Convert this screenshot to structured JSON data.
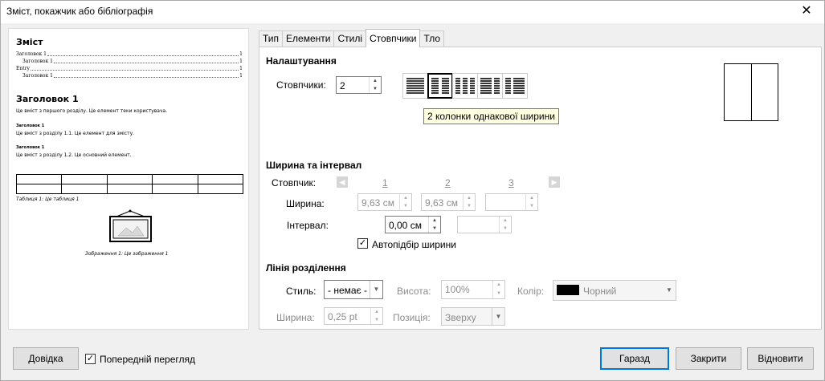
{
  "window": {
    "title": "Зміст, покажчик або бібліографія",
    "close_glyph": "✕"
  },
  "preview": {
    "toc_title": "Зміст",
    "toc_lines": [
      {
        "text": "Заголовок 1",
        "page": "1"
      },
      {
        "text": "Заголовок 1",
        "page": "1"
      },
      {
        "text": "Entry",
        "page": "1"
      },
      {
        "text": "Заголовок 1",
        "page": "1"
      }
    ],
    "heading1": "Заголовок 1",
    "text1": "Це вміст з першого розділу. Це елемент теки користувача.",
    "heading_a": "Заголовок 1",
    "text_a": "Це вміст з розділу 1.1. Це елемент для змісту.",
    "heading_b": "Заголовок 1",
    "text_b": "Це вміст з розділу 1.2. Це основний елемент.",
    "table_caption": "Таблиця 1: Це таблиця 1",
    "image_caption": "Зображення 1: Це зображення 1"
  },
  "tabs": [
    {
      "label": "Тип"
    },
    {
      "label": "Елементи"
    },
    {
      "label": "Стилі"
    },
    {
      "label": "Стовпчики",
      "active": true
    },
    {
      "label": "Тло"
    }
  ],
  "settings": {
    "title": "Налаштування",
    "columns_label": "Стовпчики:",
    "columns_value": "2",
    "presets": [
      "1 колонка",
      "2 колонки однакової ширини",
      "3 колонки",
      "2 колонки (ліва ширша)",
      "2 колонки (права ширша)"
    ],
    "tooltip": "2 колонки однакової ширини"
  },
  "width_spacing": {
    "title": "Ширина та інтервал",
    "column_label": "Стовпчик:",
    "col_numbers": [
      "1",
      "2",
      "3"
    ],
    "width_label": "Ширина:",
    "widths": [
      "9,63 см",
      "9,63 см",
      ""
    ],
    "spacing_label": "Інтервал:",
    "spacings": [
      "0,00 см",
      ""
    ],
    "autofit_label": "Автопідбір ширини",
    "autofit_checked": true
  },
  "separator": {
    "title": "Лінія розділення",
    "style_label": "Стиль:",
    "style_value": "- немає -",
    "height_label": "Висота:",
    "height_value": "100%",
    "color_label": "Колір:",
    "color_value": "Чорний",
    "color_hex": "#000000",
    "width_label": "Ширина:",
    "width_value": "0,25 pt",
    "position_label": "Позиція:",
    "position_value": "Зверху"
  },
  "footer": {
    "help": "Довідка",
    "preview_label": "Попередній перегляд",
    "preview_checked": true,
    "ok": "Гаразд",
    "close": "Закрити",
    "reset": "Відновити"
  }
}
